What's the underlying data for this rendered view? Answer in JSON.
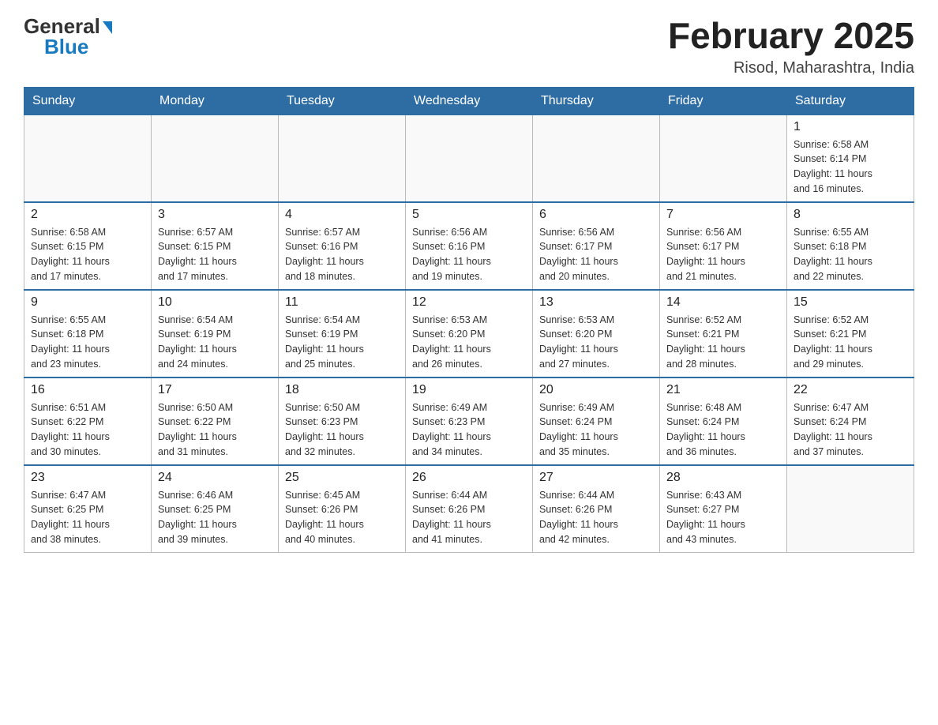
{
  "logo": {
    "general": "General",
    "blue": "Blue",
    "triangle": "▲"
  },
  "title": "February 2025",
  "location": "Risod, Maharashtra, India",
  "days_of_week": [
    "Sunday",
    "Monday",
    "Tuesday",
    "Wednesday",
    "Thursday",
    "Friday",
    "Saturday"
  ],
  "weeks": [
    [
      {
        "day": "",
        "info": ""
      },
      {
        "day": "",
        "info": ""
      },
      {
        "day": "",
        "info": ""
      },
      {
        "day": "",
        "info": ""
      },
      {
        "day": "",
        "info": ""
      },
      {
        "day": "",
        "info": ""
      },
      {
        "day": "1",
        "info": "Sunrise: 6:58 AM\nSunset: 6:14 PM\nDaylight: 11 hours\nand 16 minutes."
      }
    ],
    [
      {
        "day": "2",
        "info": "Sunrise: 6:58 AM\nSunset: 6:15 PM\nDaylight: 11 hours\nand 17 minutes."
      },
      {
        "day": "3",
        "info": "Sunrise: 6:57 AM\nSunset: 6:15 PM\nDaylight: 11 hours\nand 17 minutes."
      },
      {
        "day": "4",
        "info": "Sunrise: 6:57 AM\nSunset: 6:16 PM\nDaylight: 11 hours\nand 18 minutes."
      },
      {
        "day": "5",
        "info": "Sunrise: 6:56 AM\nSunset: 6:16 PM\nDaylight: 11 hours\nand 19 minutes."
      },
      {
        "day": "6",
        "info": "Sunrise: 6:56 AM\nSunset: 6:17 PM\nDaylight: 11 hours\nand 20 minutes."
      },
      {
        "day": "7",
        "info": "Sunrise: 6:56 AM\nSunset: 6:17 PM\nDaylight: 11 hours\nand 21 minutes."
      },
      {
        "day": "8",
        "info": "Sunrise: 6:55 AM\nSunset: 6:18 PM\nDaylight: 11 hours\nand 22 minutes."
      }
    ],
    [
      {
        "day": "9",
        "info": "Sunrise: 6:55 AM\nSunset: 6:18 PM\nDaylight: 11 hours\nand 23 minutes."
      },
      {
        "day": "10",
        "info": "Sunrise: 6:54 AM\nSunset: 6:19 PM\nDaylight: 11 hours\nand 24 minutes."
      },
      {
        "day": "11",
        "info": "Sunrise: 6:54 AM\nSunset: 6:19 PM\nDaylight: 11 hours\nand 25 minutes."
      },
      {
        "day": "12",
        "info": "Sunrise: 6:53 AM\nSunset: 6:20 PM\nDaylight: 11 hours\nand 26 minutes."
      },
      {
        "day": "13",
        "info": "Sunrise: 6:53 AM\nSunset: 6:20 PM\nDaylight: 11 hours\nand 27 minutes."
      },
      {
        "day": "14",
        "info": "Sunrise: 6:52 AM\nSunset: 6:21 PM\nDaylight: 11 hours\nand 28 minutes."
      },
      {
        "day": "15",
        "info": "Sunrise: 6:52 AM\nSunset: 6:21 PM\nDaylight: 11 hours\nand 29 minutes."
      }
    ],
    [
      {
        "day": "16",
        "info": "Sunrise: 6:51 AM\nSunset: 6:22 PM\nDaylight: 11 hours\nand 30 minutes."
      },
      {
        "day": "17",
        "info": "Sunrise: 6:50 AM\nSunset: 6:22 PM\nDaylight: 11 hours\nand 31 minutes."
      },
      {
        "day": "18",
        "info": "Sunrise: 6:50 AM\nSunset: 6:23 PM\nDaylight: 11 hours\nand 32 minutes."
      },
      {
        "day": "19",
        "info": "Sunrise: 6:49 AM\nSunset: 6:23 PM\nDaylight: 11 hours\nand 34 minutes."
      },
      {
        "day": "20",
        "info": "Sunrise: 6:49 AM\nSunset: 6:24 PM\nDaylight: 11 hours\nand 35 minutes."
      },
      {
        "day": "21",
        "info": "Sunrise: 6:48 AM\nSunset: 6:24 PM\nDaylight: 11 hours\nand 36 minutes."
      },
      {
        "day": "22",
        "info": "Sunrise: 6:47 AM\nSunset: 6:24 PM\nDaylight: 11 hours\nand 37 minutes."
      }
    ],
    [
      {
        "day": "23",
        "info": "Sunrise: 6:47 AM\nSunset: 6:25 PM\nDaylight: 11 hours\nand 38 minutes."
      },
      {
        "day": "24",
        "info": "Sunrise: 6:46 AM\nSunset: 6:25 PM\nDaylight: 11 hours\nand 39 minutes."
      },
      {
        "day": "25",
        "info": "Sunrise: 6:45 AM\nSunset: 6:26 PM\nDaylight: 11 hours\nand 40 minutes."
      },
      {
        "day": "26",
        "info": "Sunrise: 6:44 AM\nSunset: 6:26 PM\nDaylight: 11 hours\nand 41 minutes."
      },
      {
        "day": "27",
        "info": "Sunrise: 6:44 AM\nSunset: 6:26 PM\nDaylight: 11 hours\nand 42 minutes."
      },
      {
        "day": "28",
        "info": "Sunrise: 6:43 AM\nSunset: 6:27 PM\nDaylight: 11 hours\nand 43 minutes."
      },
      {
        "day": "",
        "info": ""
      }
    ]
  ]
}
